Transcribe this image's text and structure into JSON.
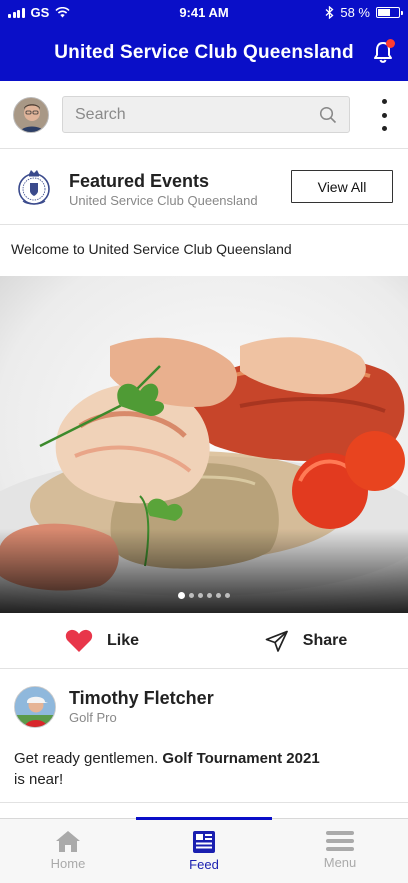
{
  "status_bar": {
    "carrier": "GS",
    "time": "9:41 AM",
    "battery": "58 %"
  },
  "header": {
    "title": "United Service Club Queensland"
  },
  "search": {
    "placeholder": "Search"
  },
  "featured": {
    "title": "Featured Events",
    "subtitle": "United Service Club Queensland",
    "view_all_label": "View All"
  },
  "welcome_text": "Welcome to United Service Club Queensland",
  "carousel": {
    "total_slides": 6,
    "active_slide": 1
  },
  "actions": {
    "like_label": "Like",
    "share_label": "Share"
  },
  "post": {
    "author": "Timothy Fletcher",
    "role": "Golf Pro",
    "text_prefix": "Get ready gentlemen. ",
    "text_bold": "Golf Tournament 2021",
    "text_suffix": " is near!"
  },
  "tabs": [
    {
      "label": "Home",
      "icon": "home-icon",
      "active": false
    },
    {
      "label": "Feed",
      "icon": "feed-icon",
      "active": true
    },
    {
      "label": "Menu",
      "icon": "menu-icon",
      "active": false
    }
  ],
  "colors": {
    "brand_blue": "#0a0fc8",
    "like_red": "#e8364a"
  }
}
